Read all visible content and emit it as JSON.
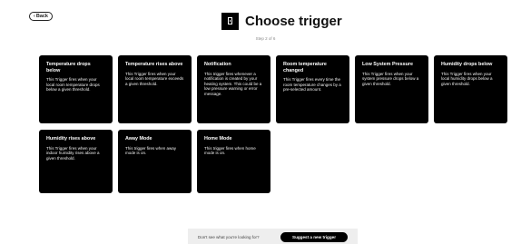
{
  "nav": {
    "back_label": "Back",
    "back_icon": "chevron-left-icon"
  },
  "header": {
    "title": "Choose trigger",
    "step": "Step 2 of 6",
    "logo_icon": "thermostat-icon"
  },
  "triggers": [
    {
      "title": "Temperature drops below",
      "description": "This Trigger fires when your local room temperature drops below a given threshold."
    },
    {
      "title": "Temperature rises above",
      "description": "This Trigger fires when your local room temperature exceeds a given threshold."
    },
    {
      "title": "Notification",
      "description": "This trigger fires whenever a notification is created by your heating system. This could be a low pressure warning or error message."
    },
    {
      "title": "Room temperature changed",
      "description": "This Trigger fires every time the room temperature changes by a pre-selected amount."
    },
    {
      "title": "Low System Pressure",
      "description": "This Trigger fires when your system pressure drops below a given threshold."
    },
    {
      "title": "Humidity drops below",
      "description": "This Trigger fires when your local humidity drops below a given threshold."
    },
    {
      "title": "Humidity rises above",
      "description": "This Trigger fires when your indoor humidity rises above a given threshold."
    },
    {
      "title": "Away Mode",
      "description": "This trigger fires when away mode is on."
    },
    {
      "title": "Home Mode",
      "description": "This trigger fires when home mode is on."
    }
  ],
  "footer": {
    "prompt": "Don't see what you're looking for?",
    "suggest_label": "Suggest a new trigger"
  },
  "colors": {
    "card_bg": "#000000",
    "card_text": "#ffffff",
    "footer_bg": "#eeeeee",
    "step_text": "#8a8a8a"
  }
}
